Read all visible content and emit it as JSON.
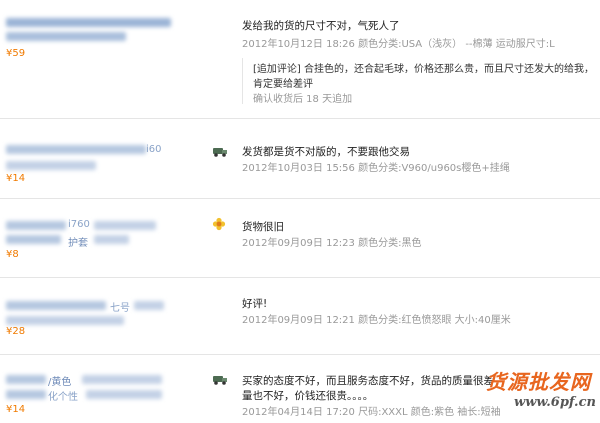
{
  "reviews": [
    {
      "price": "¥59",
      "text": "发给我的货的尺寸不对，气死人了",
      "meta": "2012年10月12日 18:26 颜色分类:USA（浅灰） --棉薄   运动服尺寸:L",
      "follow_up": {
        "text_line1": "[追加评论] 合挂色的，还合起毛球，价格还那么贵，而且尺寸还发大的给我，",
        "text_line2": "肯定要给差评",
        "meta": "确认收货后 18 天追加"
      }
    },
    {
      "price": "¥14",
      "product_fragment": "i60",
      "icon": "car-icon",
      "text": "发货都是货不对版的，不要跟他交易",
      "meta": "2012年10月03日 15:56 颜色分类:V960/u960s樱色+挂绳"
    },
    {
      "price": "¥8",
      "product_fragment_1": "i760",
      "product_fragment_2": "护套",
      "icon": "flower-icon",
      "text": "货物很旧",
      "meta": "2012年09月09日 12:23 颜色分类:黑色"
    },
    {
      "price": "¥28",
      "product_fragment": "七号",
      "text": "好评!",
      "meta": "2012年09月09日 12:21 颜色分类:红色愤怒眼   大小:40厘米"
    },
    {
      "price": "¥14",
      "product_fragment_1": "/黄色",
      "product_fragment_2": "化个性",
      "icon": "car-icon",
      "text_line1": "买家的态度不好，而且服务态度不好，货品的质量很差，",
      "text_line2": "量也不好，价钱还很贵。。。。",
      "meta": "2012年04月14日 17:20 尺码:XXXL   颜色:紫色   袖长:短袖"
    }
  ],
  "watermark": {
    "brand": "货源批发网",
    "url": "www.6pf.cn"
  },
  "colors": {
    "price": "#f07a00",
    "meta": "#999999",
    "watermark": "#e8661f"
  }
}
